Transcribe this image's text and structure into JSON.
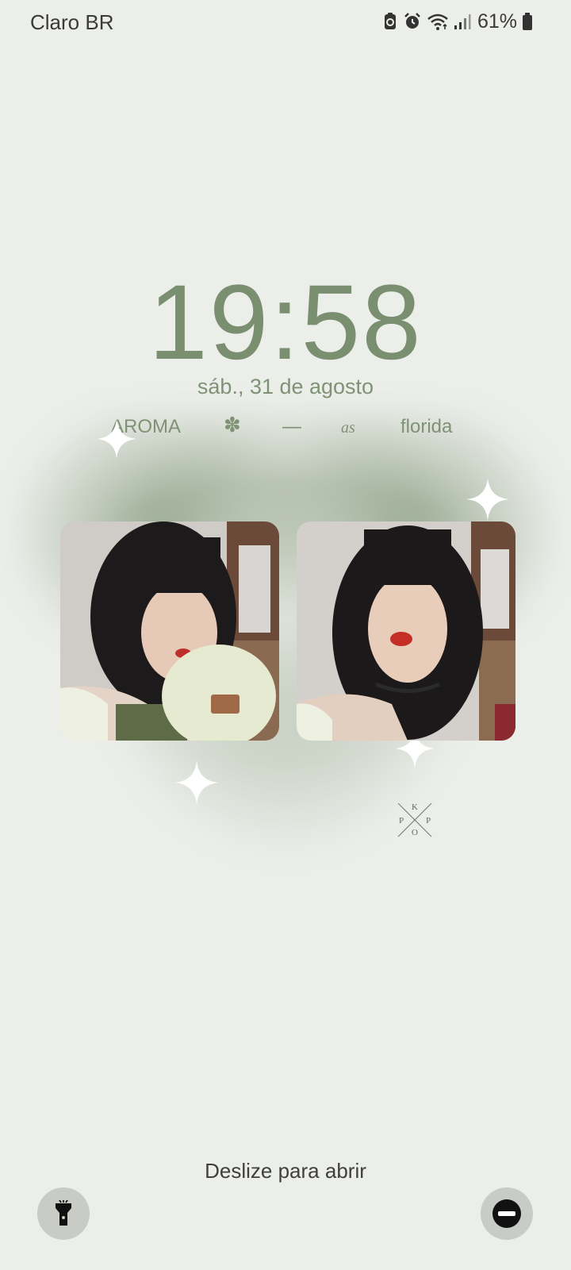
{
  "status_bar": {
    "carrier": "Claro BR",
    "battery": "61%",
    "icons": [
      "recycle-battery-icon",
      "alarm-icon",
      "wifi-icon",
      "signal-icon",
      "battery-icon"
    ]
  },
  "lock_screen": {
    "time": "19:58",
    "date": "sáb., 31 de agosto",
    "tagline": {
      "word1": "AROMA",
      "symbol": "✽",
      "dash": "—",
      "script": "as",
      "word2": "florida"
    },
    "photos": [
      "photo-left",
      "photo-right"
    ],
    "logo_letters": [
      "K",
      "P",
      "P",
      "O"
    ],
    "unlock_hint": "Deslize para abrir"
  },
  "shortcuts": {
    "left": "flashlight-icon",
    "right": "do-not-disturb-icon"
  },
  "colors": {
    "background": "#eceeea",
    "accent_green": "#7a8e70",
    "shortcut_bg": "#c9cbc7"
  }
}
